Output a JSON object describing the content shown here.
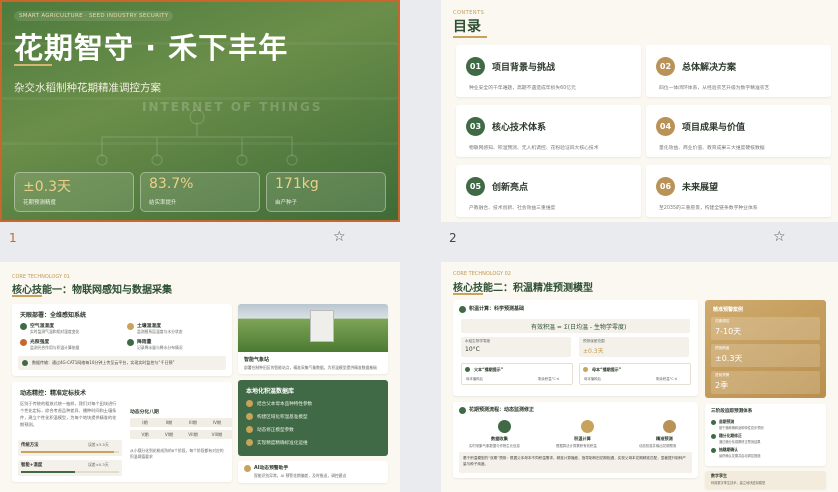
{
  "slides": [
    {
      "number": "1",
      "tag": "SMART AGRICULTURE · SEED INDUSTRY SECURITY",
      "title": "花期智守 · 禾下丰年",
      "subtitle": "杂交水稻制种花期精准调控方案",
      "watermark": "INTERNET OF THINGS",
      "stats": [
        {
          "value": "±0.3天",
          "label": "花期预测精度"
        },
        {
          "value": "83.7%",
          "label": "结实率提升"
        },
        {
          "value": "171kg",
          "label": "亩产种子"
        }
      ]
    },
    {
      "number": "2",
      "small": "CONTENTS",
      "title": "目录",
      "items": [
        {
          "num": "01",
          "title": "项目背景与挑战",
          "desc": "种业安全的千年难题，高期不遇造成年损失60亿元"
        },
        {
          "num": "02",
          "title": "总体解决方案",
          "desc": "四位一体闭环体系，从经验农艺升级为数字精准农艺"
        },
        {
          "num": "03",
          "title": "核心技术体系",
          "desc": "物联网感知、积温预测、无人机调控、花粉验证四大核心技术"
        },
        {
          "num": "04",
          "title": "项目成果与价值",
          "desc": "量化效益、商业价值、教育成果三大维度硬核数据"
        },
        {
          "num": "05",
          "title": "创新亮点",
          "desc": "产教融合、技术创新、社会效益三重维度"
        },
        {
          "num": "06",
          "title": "未来展望",
          "desc": "至2035的三重愿景，构建全链条数字种业体系"
        }
      ]
    },
    {
      "number": "",
      "small": "CORE TECHNOLOGY 01",
      "title": "核心技能一：物联网感知与数据采集",
      "network_title": "天眼部署：全维感知系统",
      "sensors": [
        {
          "name": "空气温湿度",
          "desc": "实时监测气温和相对湿度变化"
        },
        {
          "name": "土壤温湿度",
          "desc": "监测根系层温度与水分状态"
        },
        {
          "name": "光照强度",
          "desc": "监测光合作用与积温计算依据"
        },
        {
          "name": "降雨量",
          "desc": "记录降水量与降水分布情况"
        }
      ],
      "transmit": "数据传输：通过4G-CAT1网络每10分钟上传至云平台，实现实时监控与“千日预”",
      "dynamic_title": "动态精控：精准定标技术",
      "dynamic_desc": "区别于传统的粗放式统一抽样，我们对每个田块进行个性化定标，综合考虑品种差异、播种时间和土壤条件，建立个性化积温模型，为每个地块提供精准的花期预测。",
      "bars": [
        {
          "label": "传统方法",
          "value": "误差±3-5天",
          "fill": 0.95
        },
        {
          "label": "智能+温度",
          "value": "误差±0.3天",
          "fill": 0.55
        }
      ],
      "grid_title": "动态分化八期",
      "grid": [
        "I期",
        "II期",
        "III期",
        "IV期",
        "V期",
        "VI期",
        "VII期",
        "VIII期"
      ],
      "grid_note": "从小穗分化到花粉成熟的8个阶段，每个阶段都有对应的积温阈值要求",
      "station_title": "智能气象站",
      "station_desc": "部署在制种田区的智能站点，精准采集气象数据，为积温模型提供精准数据基础",
      "dark_title": "本地化积温数据库",
      "dark_items": [
        "结合父本母本品种特性参数",
        "构建区域化积温基准模型",
        "动态修正模型参数",
        "实现精度精确标准化运维"
      ],
      "ai_title": "AI动态预警助手",
      "ai_desc": "智能识别异常，AI 预警花期偏差，及时推送，调控建议"
    },
    {
      "number": "",
      "small": "CORE TECHNOLOGY 02",
      "title": "核心技能二：积温精准预测模型",
      "formula_title": "积温计算：科学预测基础",
      "formula": "有效积温 = Σ(日均温 - 生物学零度)",
      "params": [
        {
          "label": "水稻生物学零度",
          "value": "10°C"
        },
        {
          "label": "预测误差范围",
          "value": "±0.3天"
        }
      ],
      "days": [
        {
          "label": "父本“播期提示”",
          "left": "母本播种后",
          "right": "剩余积温°C·d"
        },
        {
          "label": "母本“播期提示”",
          "left": "母本播种后",
          "right": "剩余积温°C·d"
        }
      ],
      "stage_title": "花期预测流程：动态监测修正",
      "stages": [
        {
          "name": "数据收集",
          "desc": "实时采集气象数据与作物生长信息"
        },
        {
          "name": "积温计算",
          "desc": "根据算法计算累积有效积温"
        },
        {
          "name": "精准预测",
          "desc": "动态校准并输出花期预测"
        }
      ],
      "note": "基于积温模型的“双期”预测：根据父本母本不同积温需求，精准计算播差，指导制种田花期相遇，实现父母本花期精准匹配，显著提升制种产量与种子纯度。",
      "gold_title": "精准预警案例",
      "gold_boxes": [
        {
          "label": "花期调控",
          "value": "7-10天"
        },
        {
          "label": "预测精度",
          "value": "±0.3天"
        },
        {
          "label": "提前预警",
          "value": "2季"
        }
      ],
      "checks_title": "三阶段追踪预测体系",
      "checks": [
        {
          "name": "苗期预测",
          "desc": "基于播种期和品种特性初步预测"
        },
        {
          "name": "穗分化期修正",
          "desc": "通过穗分化观察修正预测结果"
        },
        {
          "name": "抽穗期确认",
          "desc": "最终确认花期并启动调控措施"
        }
      ],
      "bottom": "数字孪生",
      "bottom_desc": "利用数字孪生技术，建立地块虚拟模型"
    }
  ],
  "colors": {
    "accent": "#c8662c",
    "green": "#2e4f34",
    "gold": "#c8a35b"
  }
}
